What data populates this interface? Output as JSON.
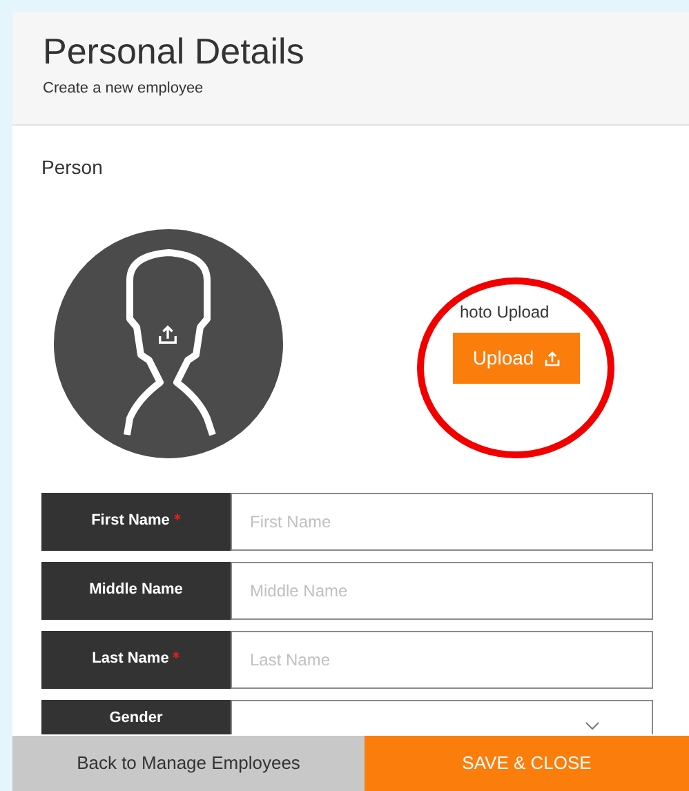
{
  "header": {
    "title": "Personal Details",
    "subtitle": "Create a new employee"
  },
  "section": {
    "title": "Person"
  },
  "photo": {
    "label": "hoto Upload",
    "button": "Upload"
  },
  "fields": [
    {
      "kind": "text",
      "label": "First Name",
      "required": true,
      "placeholder": "First Name"
    },
    {
      "kind": "text",
      "label": "Middle Name",
      "required": false,
      "placeholder": "Middle Name"
    },
    {
      "kind": "text",
      "label": "Last Name",
      "required": true,
      "placeholder": "Last Name"
    },
    {
      "kind": "select",
      "label": "Gender",
      "required": false
    }
  ],
  "footer": {
    "back": "Back to Manage Employees",
    "save": "SAVE & CLOSE"
  }
}
